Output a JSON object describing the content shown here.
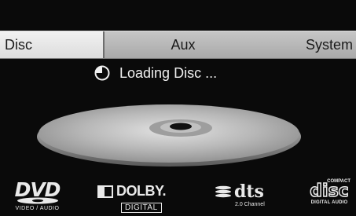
{
  "tabs": [
    {
      "label": "Disc",
      "selected": true
    },
    {
      "label": "Aux",
      "selected": false
    },
    {
      "label": "System",
      "selected": false
    }
  ],
  "status": {
    "text": "Loading Disc ...",
    "icon": "clock-icon"
  },
  "logos": {
    "dvd": {
      "word": "DVD",
      "sub": "VIDEO / AUDIO"
    },
    "dolby": {
      "word": "DOLBY.",
      "sub": "DIGITAL"
    },
    "dts": {
      "word": "dts",
      "sub": "2.0 Channel"
    },
    "cd": {
      "top": "COMPACT",
      "word": "disc",
      "sub": "DIGITAL AUDIO"
    }
  },
  "colors": {
    "background": "#0a0a0a",
    "tab_bar": "#b8b8b8",
    "tab_selected": "#e8e8e8",
    "text_light": "#f0f0f0"
  }
}
